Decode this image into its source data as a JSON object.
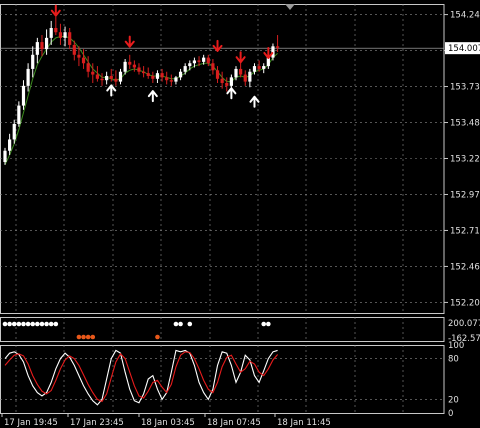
{
  "colors": {
    "background": "#000000",
    "grid": "#8a8a8a",
    "frame": "#c8c8c8",
    "bull_candle": "#ffffff",
    "bear_candle": "#d81e1e",
    "ma_line": "#3c8c1e",
    "arrow_down": "#e81c1c",
    "arrow_up": "#ffffff",
    "dot_white": "#ffffff",
    "dot_orange": "#e8581a",
    "price_label_text": "#000000",
    "axis_text": "#e0e0e0",
    "stoch_main": "#ffffff",
    "stoch_signal": "#e81c1c"
  },
  "chart_data": [
    {
      "type": "candlestick",
      "name": "price",
      "ylim": [
        152.13,
        154.32
      ],
      "y_ticks": [
        "154.245",
        "153.990",
        "153.735",
        "153.480",
        "153.225",
        "152.970",
        "152.715",
        "152.460",
        "152.205"
      ],
      "current_price": "154.007",
      "x_ticks": [
        "17 Jan 19:45",
        "17 Jan 23:45",
        "18 Jan 03:45",
        "18 Jan 07:45",
        "18 Jan 11:45"
      ],
      "grid": true,
      "candles": [
        [
          153.2,
          153.3,
          153.18,
          153.28
        ],
        [
          153.28,
          153.4,
          153.25,
          153.36
        ],
        [
          153.36,
          153.5,
          153.33,
          153.47
        ],
        [
          153.47,
          153.63,
          153.45,
          153.6
        ],
        [
          153.6,
          153.78,
          153.57,
          153.74
        ],
        [
          153.74,
          153.9,
          153.7,
          153.86
        ],
        [
          153.86,
          154.02,
          153.8,
          153.96
        ],
        [
          153.96,
          154.08,
          153.9,
          154.05
        ],
        [
          154.05,
          154.1,
          153.95,
          154.0
        ],
        [
          154.0,
          154.14,
          153.96,
          154.08
        ],
        [
          154.08,
          154.2,
          154.03,
          154.15
        ],
        [
          154.15,
          154.23,
          154.1,
          154.12
        ],
        [
          154.12,
          154.18,
          154.03,
          154.08
        ],
        [
          154.08,
          154.16,
          154.02,
          154.12
        ],
        [
          154.12,
          154.15,
          154.0,
          154.03
        ],
        [
          154.03,
          154.06,
          153.92,
          153.96
        ],
        [
          153.96,
          154.02,
          153.88,
          153.94
        ],
        [
          153.94,
          154.0,
          153.86,
          153.9
        ],
        [
          153.9,
          153.95,
          153.8,
          153.84
        ],
        [
          153.84,
          153.9,
          153.76,
          153.82
        ],
        [
          153.82,
          153.88,
          153.77,
          153.79
        ],
        [
          153.79,
          153.83,
          153.74,
          153.78
        ],
        [
          153.78,
          153.84,
          153.75,
          153.81
        ],
        [
          153.81,
          153.86,
          153.77,
          153.79
        ],
        [
          153.79,
          153.85,
          153.74,
          153.77
        ],
        [
          153.77,
          153.86,
          153.75,
          153.84
        ],
        [
          153.84,
          153.93,
          153.82,
          153.91
        ],
        [
          153.91,
          153.96,
          153.86,
          153.89
        ],
        [
          153.89,
          153.92,
          153.84,
          153.87
        ],
        [
          153.87,
          153.9,
          153.82,
          153.84
        ],
        [
          153.84,
          153.88,
          153.8,
          153.83
        ],
        [
          153.83,
          153.87,
          153.79,
          153.81
        ],
        [
          153.81,
          153.84,
          153.76,
          153.79
        ],
        [
          153.79,
          153.85,
          153.76,
          153.83
        ],
        [
          153.83,
          153.86,
          153.77,
          153.8
        ],
        [
          153.8,
          153.84,
          153.75,
          153.78
        ],
        [
          153.78,
          153.82,
          153.74,
          153.77
        ],
        [
          153.77,
          153.81,
          153.75,
          153.8
        ],
        [
          153.8,
          153.86,
          153.78,
          153.84
        ],
        [
          153.84,
          153.9,
          153.82,
          153.88
        ],
        [
          153.88,
          153.92,
          153.85,
          153.9
        ],
        [
          153.9,
          153.94,
          153.87,
          153.92
        ],
        [
          153.92,
          153.95,
          153.88,
          153.91
        ],
        [
          153.91,
          153.96,
          153.89,
          153.94
        ],
        [
          153.94,
          153.96,
          153.88,
          153.9
        ],
        [
          153.9,
          153.93,
          153.82,
          153.85
        ],
        [
          153.85,
          153.88,
          153.76,
          153.79
        ],
        [
          153.79,
          153.84,
          153.72,
          153.76
        ],
        [
          153.76,
          153.8,
          153.7,
          153.74
        ],
        [
          153.74,
          153.82,
          153.72,
          153.8
        ],
        [
          153.8,
          153.88,
          153.78,
          153.86
        ],
        [
          153.86,
          153.92,
          153.8,
          153.82
        ],
        [
          153.82,
          153.85,
          153.74,
          153.77
        ],
        [
          153.77,
          153.86,
          153.73,
          153.84
        ],
        [
          153.84,
          153.9,
          153.82,
          153.88
        ],
        [
          153.88,
          153.92,
          153.84,
          153.86
        ],
        [
          153.86,
          153.9,
          153.83,
          153.88
        ],
        [
          153.88,
          153.96,
          153.86,
          153.94
        ],
        [
          153.94,
          154.04,
          153.92,
          154.02
        ],
        [
          154.02,
          154.1,
          153.98,
          154.01
        ]
      ],
      "ma": [
        153.18,
        153.25,
        153.33,
        153.43,
        153.55,
        153.67,
        153.79,
        153.89,
        153.95,
        154.0,
        154.05,
        154.08,
        154.09,
        154.09,
        154.08,
        154.05,
        154.01,
        153.96,
        153.91,
        153.86,
        153.83,
        153.8,
        153.8,
        153.79,
        153.78,
        153.79,
        153.83,
        153.85,
        153.86,
        153.85,
        153.84,
        153.82,
        153.81,
        153.81,
        153.81,
        153.8,
        153.79,
        153.79,
        153.81,
        153.83,
        153.86,
        153.88,
        153.89,
        153.9,
        153.9,
        153.88,
        153.84,
        153.8,
        153.77,
        153.77,
        153.8,
        153.81,
        153.8,
        153.81,
        153.84,
        153.85,
        153.86,
        153.89,
        153.94,
        153.97
      ],
      "arrows_down": [
        [
          11,
          154.28
        ],
        [
          27,
          154.06
        ],
        [
          46,
          154.03
        ],
        [
          51,
          153.95
        ],
        [
          57,
          153.98
        ]
      ],
      "arrows_up": [
        [
          23,
          153.7
        ],
        [
          32,
          153.66
        ],
        [
          49,
          153.68
        ],
        [
          54,
          153.62
        ]
      ]
    },
    {
      "type": "dots",
      "name": "signal-dots",
      "y_ticks": [
        "200.0772",
        "-162.5747"
      ],
      "white_dots": [
        0,
        1,
        2,
        3,
        4,
        5,
        6,
        7,
        8,
        9,
        10,
        11,
        37,
        38,
        40,
        56,
        57
      ],
      "orange_dots": [
        16,
        17,
        18,
        19,
        33
      ]
    },
    {
      "type": "line",
      "name": "stochastic",
      "ylim": [
        0,
        100
      ],
      "y_ticks": [
        "100",
        "80",
        "20",
        "0"
      ],
      "series": [
        {
          "values": [
            80,
            88,
            90,
            86,
            75,
            55,
            40,
            30,
            25,
            30,
            45,
            65,
            80,
            88,
            82,
            70,
            55,
            40,
            28,
            18,
            12,
            20,
            50,
            80,
            92,
            88,
            60,
            35,
            18,
            15,
            28,
            50,
            55,
            35,
            20,
            30,
            60,
            92,
            90,
            92,
            88,
            70,
            45,
            30,
            20,
            35,
            70,
            90,
            88,
            70,
            45,
            60,
            85,
            78,
            55,
            45,
            62,
            80,
            90,
            92
          ]
        },
        {
          "values": [
            70,
            78,
            85,
            87,
            84,
            72,
            55,
            42,
            32,
            28,
            33,
            48,
            65,
            78,
            84,
            80,
            70,
            56,
            42,
            30,
            20,
            17,
            28,
            52,
            75,
            87,
            80,
            60,
            40,
            25,
            22,
            32,
            45,
            48,
            38,
            30,
            42,
            68,
            85,
            90,
            89,
            80,
            65,
            48,
            35,
            30,
            45,
            68,
            82,
            85,
            72,
            60,
            65,
            76,
            72,
            60,
            55,
            65,
            78,
            86
          ]
        }
      ]
    }
  ]
}
